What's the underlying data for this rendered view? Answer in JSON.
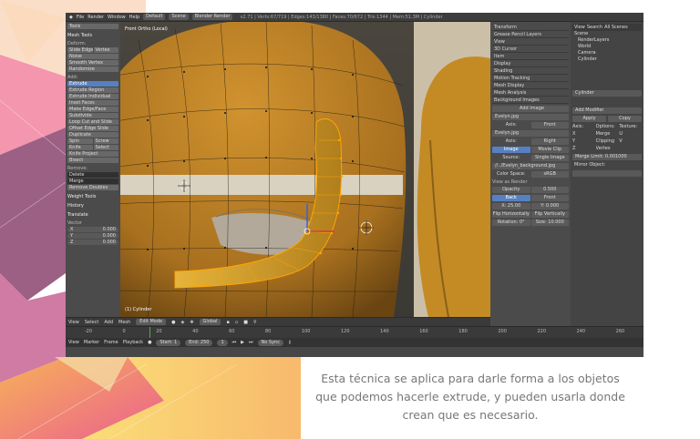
{
  "topbar": {
    "items": [
      "File",
      "Render",
      "Window",
      "Help"
    ],
    "layout": "Default",
    "scene": "Scene",
    "engine": "Blender Render",
    "stats": "v2.71 | Verts:67/719 | Edges:143/1380 | Faces:70/672 | Tris:1344 | Mem:51.3M | Cylinder"
  },
  "toolshelf": {
    "panel_tab": "Tools",
    "header_mesh_tools": "Mesh Tools",
    "deform_label": "Deform:",
    "deform_buttons": [
      "Slide Edge",
      "Vertex",
      "Noise",
      "Smooth Vertex",
      "Randomize"
    ],
    "add_label": "Add:",
    "add_buttons": [
      "Extrude",
      "Extrude Region",
      "Extrude Individual",
      "Inset Faces",
      "Make Edge/Face",
      "Subdivide",
      "Loop Cut and Slide",
      "Offset Edge Slide",
      "Duplicate"
    ],
    "spin_buttons": [
      "Spin",
      "Screw"
    ],
    "knife_buttons": [
      "Knife",
      "Select"
    ],
    "more_buttons": [
      "Knife Project",
      "Bisect"
    ],
    "remove_label": "Remove:",
    "remove_buttons": [
      "Delete",
      "Merge",
      "Remove Doubles"
    ],
    "header_weight": "Weight Tools",
    "header_history": "History",
    "header_translate": "Translate",
    "vector_label": "Vector",
    "vector_fields": [
      {
        "axis": "X",
        "value": "0.000"
      },
      {
        "axis": "Y",
        "value": "0.000"
      },
      {
        "axis": "Z",
        "value": "0.000"
      }
    ]
  },
  "viewport": {
    "label": "Front Ortho (Local)",
    "object": "(1) Cylinder"
  },
  "properties": {
    "panels": [
      "Transform",
      "Grease Pencil Layers",
      "View",
      "3D Cursor",
      "Item",
      "Display",
      "Shading",
      "Motion Tracking",
      "Mesh Display",
      "Mesh Analysis",
      "Background Images"
    ],
    "add_image": "Add Image",
    "image1": "Evelyn.jpg",
    "axis_label": "Axis:",
    "axis1": "Front",
    "image2": "Evelyn.jpg",
    "axis2": "Right",
    "tabs": [
      "Image",
      "Movie Clip"
    ],
    "source_label": "Source:",
    "source": "Single Image",
    "file": "//../Evelyn_background.jpg",
    "color_space_label": "Color Space:",
    "color_space": "sRGB",
    "view_as_render": "View as Render",
    "opacity_label": "Opacity",
    "opacity": "0.500",
    "back_front": [
      "Back",
      "Front"
    ],
    "offset": [
      "X: 25.00",
      "Y: 0.000"
    ],
    "flip": [
      "Flip Horizontally",
      "Flip Vertically"
    ],
    "rotation": [
      "Rotation: 0°",
      "Size: 10.000"
    ]
  },
  "outliner": {
    "tabs": [
      "View",
      "Search",
      "All Scenes"
    ],
    "tree": [
      "Scene",
      "RenderLayers",
      "World",
      "Camera",
      "Cylinder"
    ],
    "object_name": "Cylinder",
    "add_modifier": "Add Modifier",
    "apply": "Apply",
    "copy": "Copy",
    "columns": [
      "Axis:",
      "Options:",
      "Texture:"
    ],
    "checks": [
      "X",
      "Merge",
      "U",
      "Y",
      "Clipping",
      "V",
      "Z",
      "Vertex",
      ""
    ],
    "merge_limit": "Merge Limit: 0.001000",
    "mirror_object": "Mirror Object:"
  },
  "vpheader": {
    "items": [
      "View",
      "Select",
      "Add",
      "Mesh"
    ],
    "mode": "Edit Mode",
    "orientation": "Global"
  },
  "timeline": {
    "ticks": [
      "-20",
      "0",
      "20",
      "40",
      "60",
      "80",
      "100",
      "120",
      "140",
      "160",
      "180",
      "200",
      "220",
      "240",
      "260"
    ],
    "items": [
      "View",
      "Marker",
      "Frame",
      "Playback"
    ],
    "start": "Start: 1",
    "end": "End: 250",
    "frame": "1",
    "sync": "No Sync"
  },
  "caption": {
    "lines": [
      "Esta técnica se aplica para darle forma a los objetos",
      "que podemos hacerle extrude, y pueden usarla donde",
      "crean que es necesario."
    ]
  }
}
